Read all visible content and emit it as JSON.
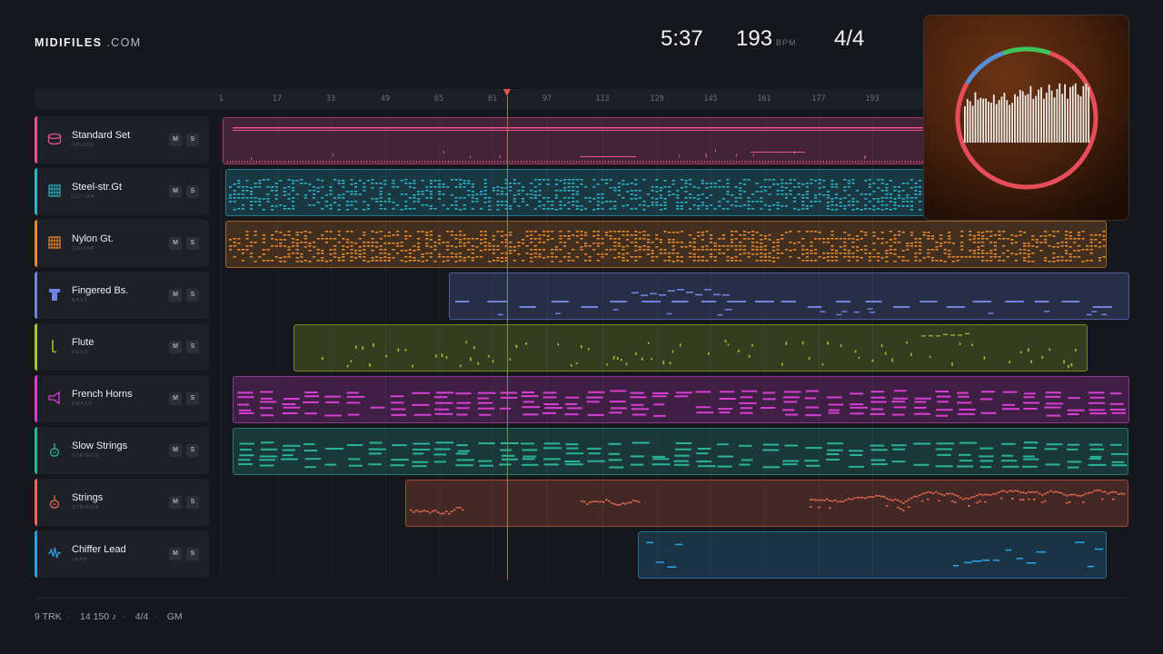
{
  "brand": {
    "name": "MIDIFILES",
    "suffix": ".COM"
  },
  "transport": {
    "time": "5:37",
    "bpm": "193",
    "bpm_unit": "BPM",
    "time_signature": "4/4"
  },
  "ruler": {
    "ticks": [
      "1",
      "17",
      "33",
      "49",
      "65",
      "81",
      "97",
      "113",
      "129",
      "145",
      "161",
      "177",
      "193"
    ]
  },
  "tracks": [
    {
      "name": "Standard Set",
      "type": "DRUMS",
      "icon": "drum-icon",
      "color": "#e8558e",
      "style": "drums"
    },
    {
      "name": "Steel-str.Gt",
      "type": "GUITAR",
      "icon": "guitar-neck-icon",
      "color": "#2bb3c8",
      "style": "dense"
    },
    {
      "name": "Nylon Gt.",
      "type": "GUITAR",
      "icon": "guitar-neck-icon",
      "color": "#e88a2c",
      "style": "dense"
    },
    {
      "name": "Fingered Bs.",
      "type": "BASS",
      "icon": "bass-icon",
      "color": "#6f84e0",
      "style": "bass"
    },
    {
      "name": "Flute",
      "type": "REED",
      "icon": "flute-icon",
      "color": "#a8c42c",
      "style": "sparse"
    },
    {
      "name": "French Horns",
      "type": "BRASS",
      "icon": "horn-icon",
      "color": "#d63fd2",
      "style": "chords"
    },
    {
      "name": "Slow Strings",
      "type": "STRINGS",
      "icon": "violin-icon",
      "color": "#2bb39a",
      "style": "chords"
    },
    {
      "name": "Strings",
      "type": "STRINGS",
      "icon": "violin-icon",
      "color": "#e8684f",
      "style": "melody"
    },
    {
      "name": "Chiffer Lead",
      "type": "LEAD",
      "icon": "waveform-icon",
      "color": "#2c9fe0",
      "style": "lead"
    }
  ],
  "buttons": {
    "mute": "M",
    "solo": "S"
  },
  "footer": {
    "tracks": "9 TRK",
    "notes": "14 150 ♪",
    "time_signature": "4/4",
    "standard": "GM"
  }
}
